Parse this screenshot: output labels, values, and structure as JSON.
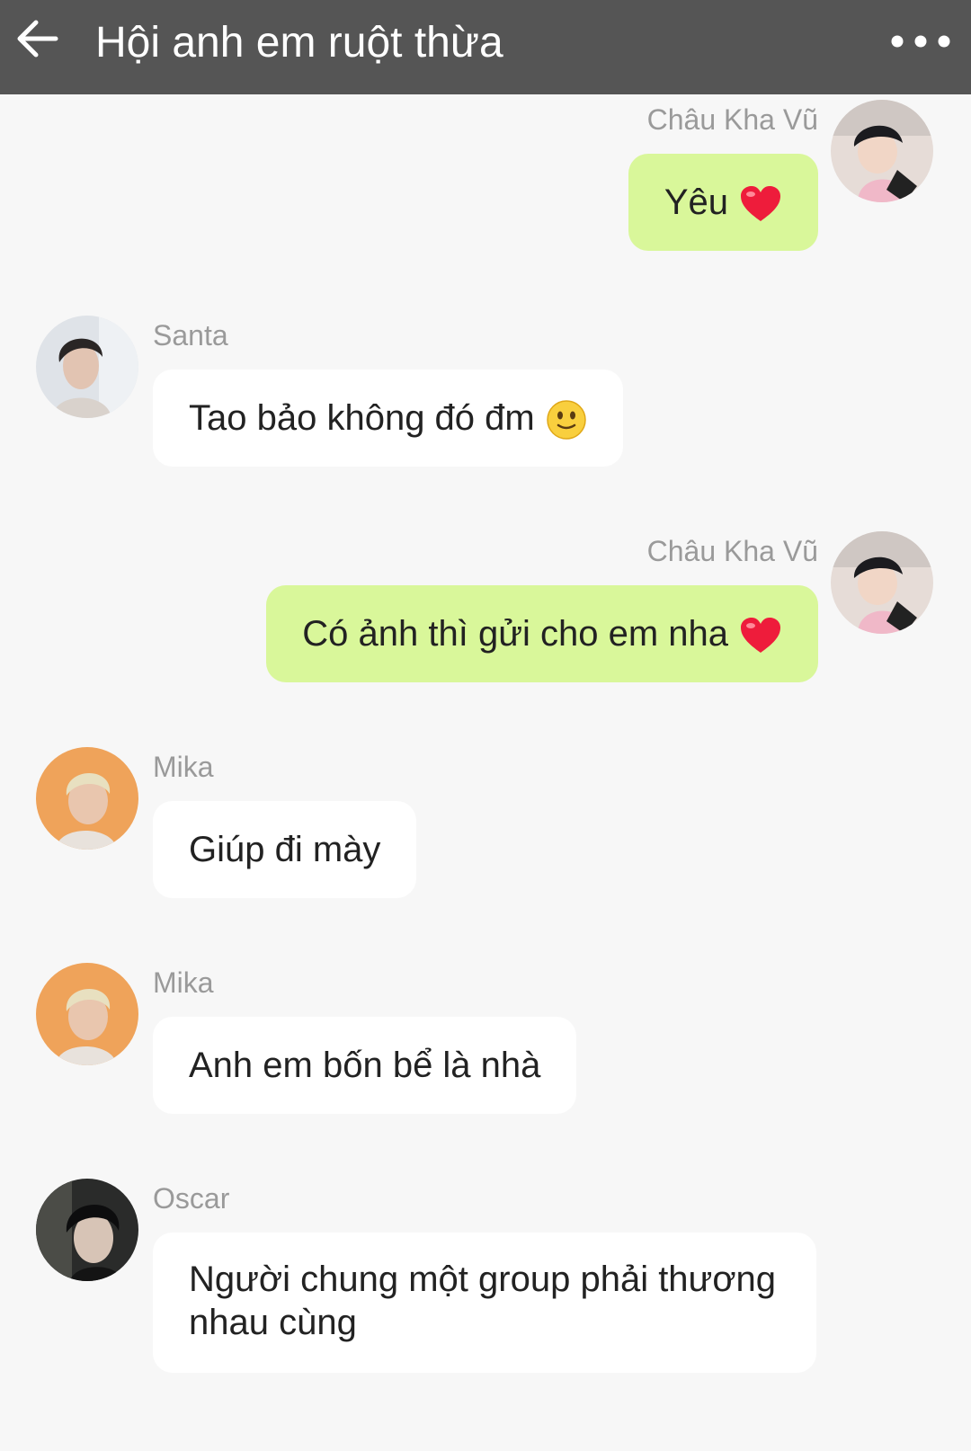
{
  "header": {
    "title": "Hội anh em ruột thừa",
    "back_icon": "arrow-left-icon",
    "more_icon": "more-horizontal-icon",
    "background": "#555555"
  },
  "colors": {
    "outgoing_bubble": "#d9f79a",
    "incoming_bubble": "#ffffff",
    "sender_name": "#9a9a9a",
    "background": "#f7f7f7"
  },
  "messages": [
    {
      "sender": "Châu Kha Vũ",
      "text": "Yêu",
      "emoji": "heart-emoji",
      "direction": "outgoing"
    },
    {
      "sender": "Santa",
      "text": "Tao bảo không đó đm",
      "emoji": "slightly-smiling-face-emoji",
      "direction": "incoming"
    },
    {
      "sender": "Châu Kha Vũ",
      "text": "Có ảnh thì gửi cho em nha",
      "emoji": "heart-emoji",
      "direction": "outgoing"
    },
    {
      "sender": "Mika",
      "text": "Giúp đi mày",
      "direction": "incoming"
    },
    {
      "sender": "Mika",
      "text": "Anh em bốn bể là nhà",
      "direction": "incoming"
    },
    {
      "sender": "Oscar",
      "text": "Người chung một group phải thương nhau cùng",
      "direction": "incoming"
    }
  ]
}
